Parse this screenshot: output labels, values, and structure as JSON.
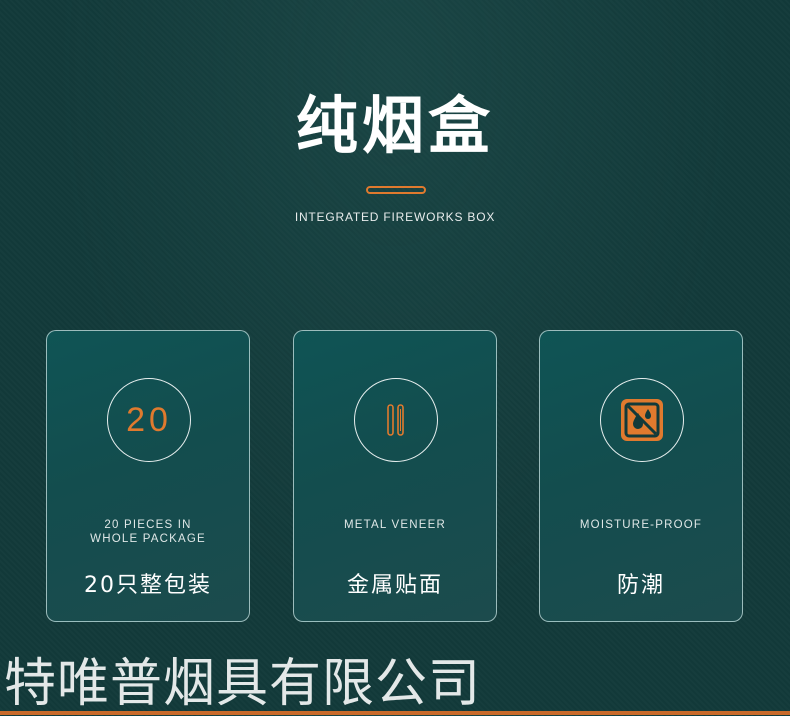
{
  "hero": {
    "title": "纯烟盒",
    "subtitle": "INTEGRATED FIREWORKS BOX"
  },
  "cards": [
    {
      "icon": "number-20-icon",
      "icon_text": "20",
      "en_label": "20 PIECES IN\nWHOLE PACKAGE",
      "cn_label": "20只整包装"
    },
    {
      "icon": "metal-veneer-icon",
      "en_label": "METAL VENEER",
      "cn_label": "金属贴面"
    },
    {
      "icon": "moisture-proof-icon",
      "en_label": "MOISTURE-PROOF",
      "cn_label": "防潮"
    }
  ],
  "footer": {
    "text": "特唯普烟具有限公司"
  },
  "colors": {
    "accent": "#e07a2e",
    "background": "#123a3a",
    "card": "#0f5455"
  }
}
